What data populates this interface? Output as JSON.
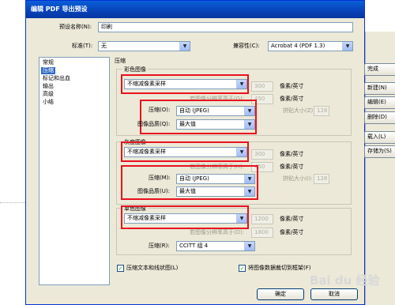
{
  "dialog": {
    "title": "编辑 PDF 导出预设",
    "preset_name_label": "预设名称(N):",
    "preset_name_value": "印刷",
    "standard_label": "标准(T):",
    "standard_value": "无",
    "compat_label": "兼容性(C):",
    "compat_value": "Acrobat 4 (PDF 1.3)"
  },
  "sidebar": {
    "items": [
      "常规",
      "压缩",
      "标记和出血",
      "输出",
      "高级",
      "小结"
    ],
    "selected": "压缩"
  },
  "panel_title": "压缩",
  "color": {
    "group_title": "彩色图像",
    "sampling": "不缩减像素采样",
    "ppi_value": "300",
    "ppi_unit": "像素/英寸",
    "above_label": "若图像分辨率高于(G):",
    "above_value": "450",
    "above_unit": "像素/英寸",
    "compress_label": "压缩(O):",
    "compress_value": "自动 (JPEG)",
    "tile_label": "拼贴大小(Z):",
    "tile_value": "128",
    "quality_label": "图像品质(Q):",
    "quality_value": "最大值"
  },
  "gray": {
    "group_title": "灰度图像",
    "sampling": "不缩减像素采样",
    "ppi_value": "300",
    "ppi_unit": "像素/英寸",
    "above_label": "若图像分辨率高于(H):",
    "above_value": "450",
    "above_unit": "像素/英寸",
    "compress_label": "压缩(M):",
    "compress_value": "自动 (JPEG)",
    "tile_label": "拼贴大小(I):",
    "tile_value": "128",
    "quality_label": "图像品质(U):",
    "quality_value": "最大值"
  },
  "mono": {
    "group_title": "单色图像",
    "sampling": "不缩减像素采样",
    "ppi_value": "1200",
    "ppi_unit": "像素/英寸",
    "above_label": "若图像分辨率高于(D):",
    "above_value": "1800",
    "above_unit": "像素/英寸",
    "compress_label": "压缩(R):",
    "compress_value": "CCITT 组 4"
  },
  "options": {
    "compress_text": "压缩文本和线状图(L)",
    "crop_images": "将图像数据裁切到框架(F)",
    "compress_text_checked": "✓",
    "crop_images_checked": "✓"
  },
  "buttons": {
    "ok": "确定",
    "cancel": "取消"
  },
  "right_pane": {
    "done": "完成",
    "new": "新建(N)",
    "edit": "编辑(E)",
    "delete": "删除(D)",
    "load": "载入(L)",
    "save_as": "存储为(S)"
  },
  "icons": {
    "dropdown": "▼"
  },
  "colors": {
    "highlight_box": "#e8121e",
    "title_bar": "#0842b8",
    "selection": "#316ac5"
  },
  "watermark": "Bai du 经验"
}
